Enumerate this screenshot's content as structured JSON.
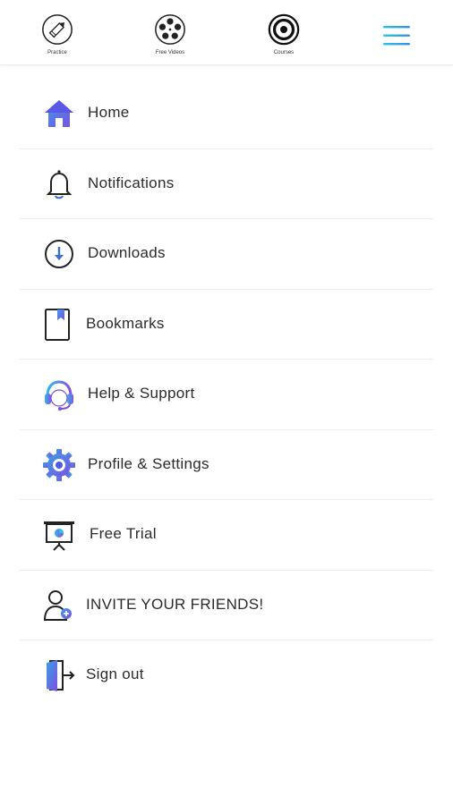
{
  "tabs": [
    {
      "label": "Practice",
      "icon": "pencil-icon"
    },
    {
      "label": "Free Videos",
      "icon": "film-reel-icon"
    },
    {
      "label": "Courses",
      "icon": "target-icon"
    }
  ],
  "menu_icon": "hamburger-menu-icon",
  "menu": {
    "items": [
      {
        "label": "Home",
        "icon": "home-icon"
      },
      {
        "label": "Notifications",
        "icon": "bell-icon"
      },
      {
        "label": "Downloads",
        "icon": "download-icon"
      },
      {
        "label": "Bookmarks",
        "icon": "bookmark-icon"
      },
      {
        "label": "Help & Support",
        "icon": "headset-icon"
      },
      {
        "label": "Profile & Settings",
        "icon": "gear-icon"
      },
      {
        "label": "Free Trial",
        "icon": "presentation-board-icon"
      },
      {
        "label": "INVITE YOUR FRIENDS!",
        "icon": "add-user-icon"
      },
      {
        "label": "Sign out",
        "icon": "sign-out-icon"
      }
    ]
  },
  "colors": {
    "accent_blue": "#3a6fd8",
    "accent_purple": "#7b4fe0",
    "accent_cyan": "#27c3e6",
    "text": "#2b2b2b",
    "divider": "#ededed"
  }
}
